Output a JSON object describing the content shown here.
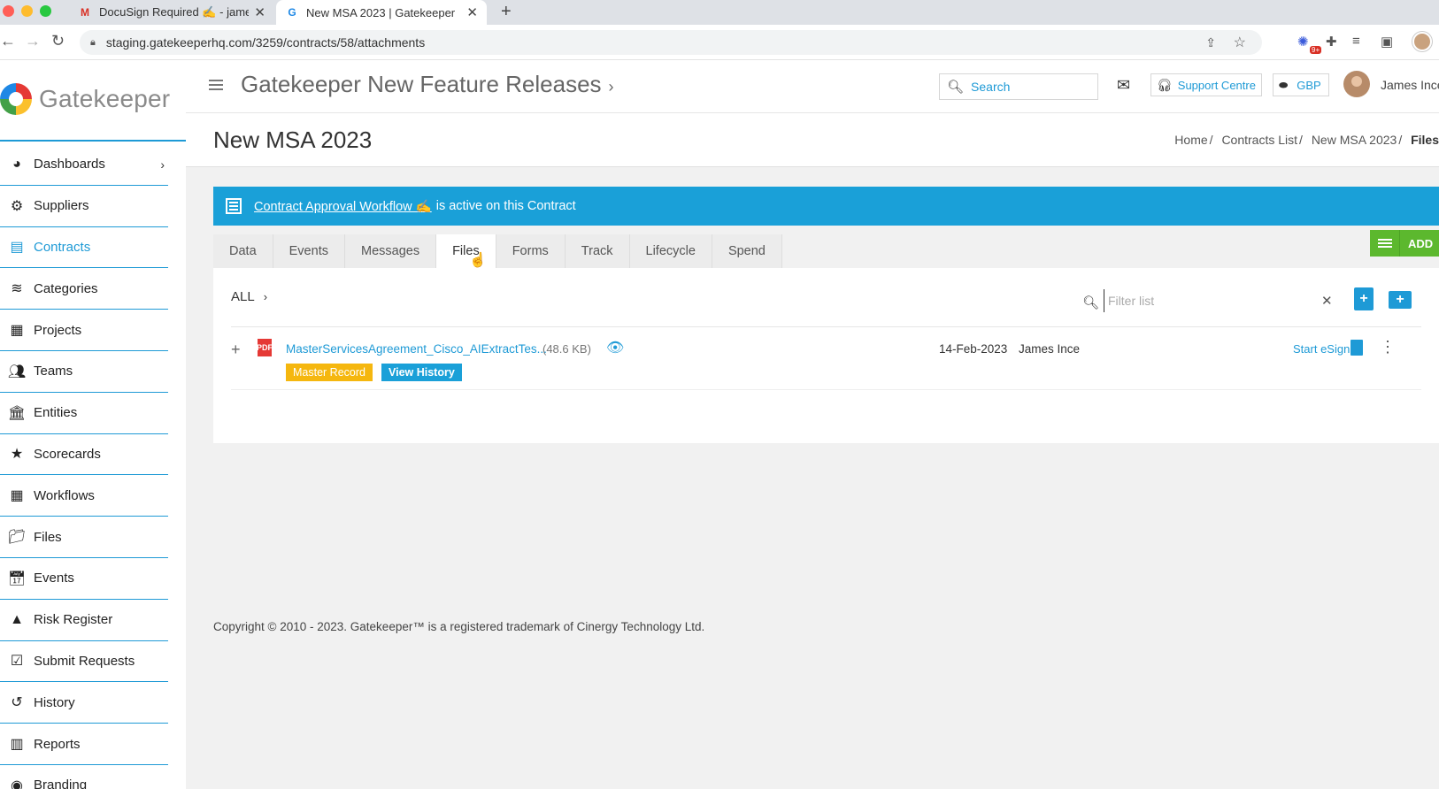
{
  "browser": {
    "tabs": [
      {
        "title": "DocuSign Required ✍️ - james",
        "active": false,
        "favicon": "gmail-icon"
      },
      {
        "title": "New MSA 2023 | Gatekeeper",
        "active": true,
        "favicon": "gatekeeper-icon"
      }
    ],
    "url": "staging.gatekeeperhq.com/3259/contracts/58/attachments",
    "extension_badge": "9+"
  },
  "app": {
    "logo_text": "Gatekeeper",
    "header_title": "Gatekeeper New Feature Releases",
    "search_placeholder": "Search",
    "support_label": "Support Centre",
    "currency": "GBP",
    "user_name": "James Ince"
  },
  "sidebar": {
    "items": [
      {
        "label": "Dashboards",
        "icon": "dashboard-icon",
        "has_chevron": true
      },
      {
        "label": "Suppliers",
        "icon": "users-cog-icon"
      },
      {
        "label": "Contracts",
        "icon": "contract-icon",
        "active": true
      },
      {
        "label": "Categories",
        "icon": "layers-icon"
      },
      {
        "label": "Projects",
        "icon": "projects-icon"
      },
      {
        "label": "Teams",
        "icon": "team-icon"
      },
      {
        "label": "Entities",
        "icon": "bank-icon"
      },
      {
        "label": "Scorecards",
        "icon": "star-icon"
      },
      {
        "label": "Workflows",
        "icon": "grid-icon"
      },
      {
        "label": "Files",
        "icon": "folder-icon"
      },
      {
        "label": "Events",
        "icon": "calendar-icon"
      },
      {
        "label": "Risk Register",
        "icon": "warning-icon"
      },
      {
        "label": "Submit Requests",
        "icon": "clipboard-check-icon"
      },
      {
        "label": "History",
        "icon": "history-icon"
      },
      {
        "label": "Reports",
        "icon": "bar-chart-icon"
      },
      {
        "label": "Branding",
        "icon": "branding-icon"
      }
    ]
  },
  "page": {
    "title": "New MSA 2023",
    "breadcrumb": [
      "Home",
      "Contracts List",
      "New MSA 2023",
      "Files"
    ],
    "workflow_banner": {
      "link_text": "Contract Approval Workflow ✍️",
      "rest_text": "is active on this Contract"
    },
    "tabs": [
      "Data",
      "Events",
      "Messages",
      "Files",
      "Forms",
      "Track",
      "Lifecycle",
      "Spend"
    ],
    "active_tab": "Files",
    "add_button": "ADD"
  },
  "files": {
    "folder_label": "ALL",
    "filter_placeholder": "Filter list",
    "rows": [
      {
        "name": "MasterServicesAgreement_Cisco_AIExtractTes...",
        "size": "(48.6 KB)",
        "badges": [
          "Master Record",
          "View History"
        ],
        "date": "14-Feb-2023",
        "owner": "James Ince",
        "action": "Start eSign"
      }
    ]
  },
  "footer": {
    "copyright": "Copyright © 2010 - 2023. Gatekeeper™ is a registered trademark of Cinergy Technology Ltd."
  },
  "colors": {
    "accent": "#1e9ad6",
    "banner": "#1aa0d8",
    "add_button": "#5cb82e",
    "master_badge": "#f5b70f",
    "pdf_red": "#e53935"
  }
}
